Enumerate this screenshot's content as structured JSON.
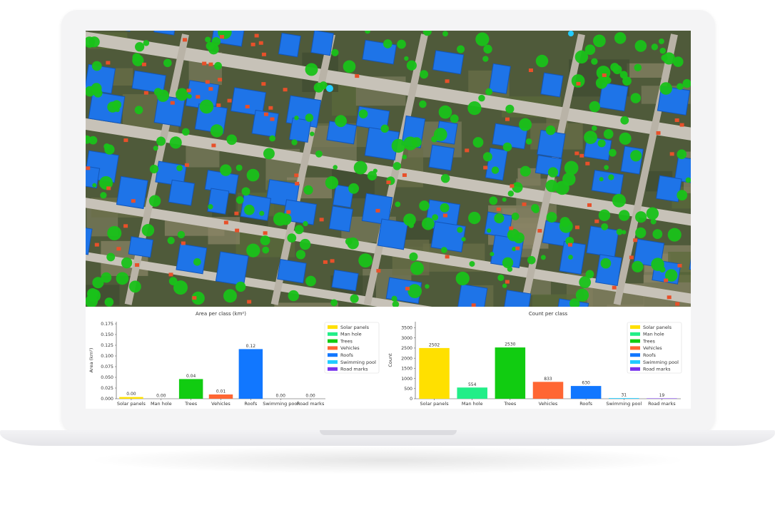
{
  "chart_data": [
    {
      "type": "bar",
      "title": "Area per class (km²)",
      "xlabel": "",
      "ylabel": "Area (km²)",
      "ylim": [
        0,
        0.18
      ],
      "yticks": [
        "0.000",
        "0.025",
        "0.050",
        "0.075",
        "0.100",
        "0.125",
        "0.150",
        "0.175"
      ],
      "categories": [
        "Solar panels",
        "Man hole",
        "Trees",
        "Vehicles",
        "Roofs",
        "Swimming pool",
        "Road marks"
      ],
      "values": [
        0.004,
        0.0,
        0.046,
        0.01,
        0.116,
        0.0,
        0.0
      ],
      "value_labels": [
        "0.00",
        "0.00",
        "0.04",
        "0.01",
        "0.12",
        "0.00",
        "0.00"
      ],
      "legend_position": "top-right",
      "legend": [
        "Solar panels",
        "Man hole",
        "Trees",
        "Vehicles",
        "Roofs",
        "Swimming pool",
        "Road marks"
      ],
      "colors": [
        "#ffe000",
        "#22ee88",
        "#11cc11",
        "#ff6633",
        "#1177ff",
        "#22ccff",
        "#7733ee"
      ]
    },
    {
      "type": "bar",
      "title": "Count per class",
      "xlabel": "",
      "ylabel": "Count",
      "ylim": [
        0,
        3800
      ],
      "yticks": [
        "0",
        "500",
        "1000",
        "1500",
        "2000",
        "2500",
        "3000",
        "3500"
      ],
      "categories": [
        "Solar panels",
        "Man hole",
        "Trees",
        "Vehicles",
        "Roofs",
        "Swimming pool",
        "Road marks"
      ],
      "values": [
        2502,
        554,
        2530,
        833,
        630,
        31,
        19
      ],
      "value_labels": [
        "2502",
        "554",
        "2530",
        "833",
        "630",
        "31",
        "19"
      ],
      "legend_position": "top-right",
      "legend": [
        "Solar panels",
        "Man hole",
        "Trees",
        "Vehicles",
        "Roofs",
        "Swimming pool",
        "Road marks"
      ],
      "colors": [
        "#ffe000",
        "#22ee88",
        "#11cc11",
        "#ff6633",
        "#1177ff",
        "#22ccff",
        "#7733ee"
      ]
    }
  ],
  "aerial": {
    "roof_color": "#1e74e8",
    "tree_color": "#19c219",
    "vehicle_color": "#e8502a",
    "road_color": "#c7c2b8",
    "ground_color": "#4f5a3a"
  }
}
